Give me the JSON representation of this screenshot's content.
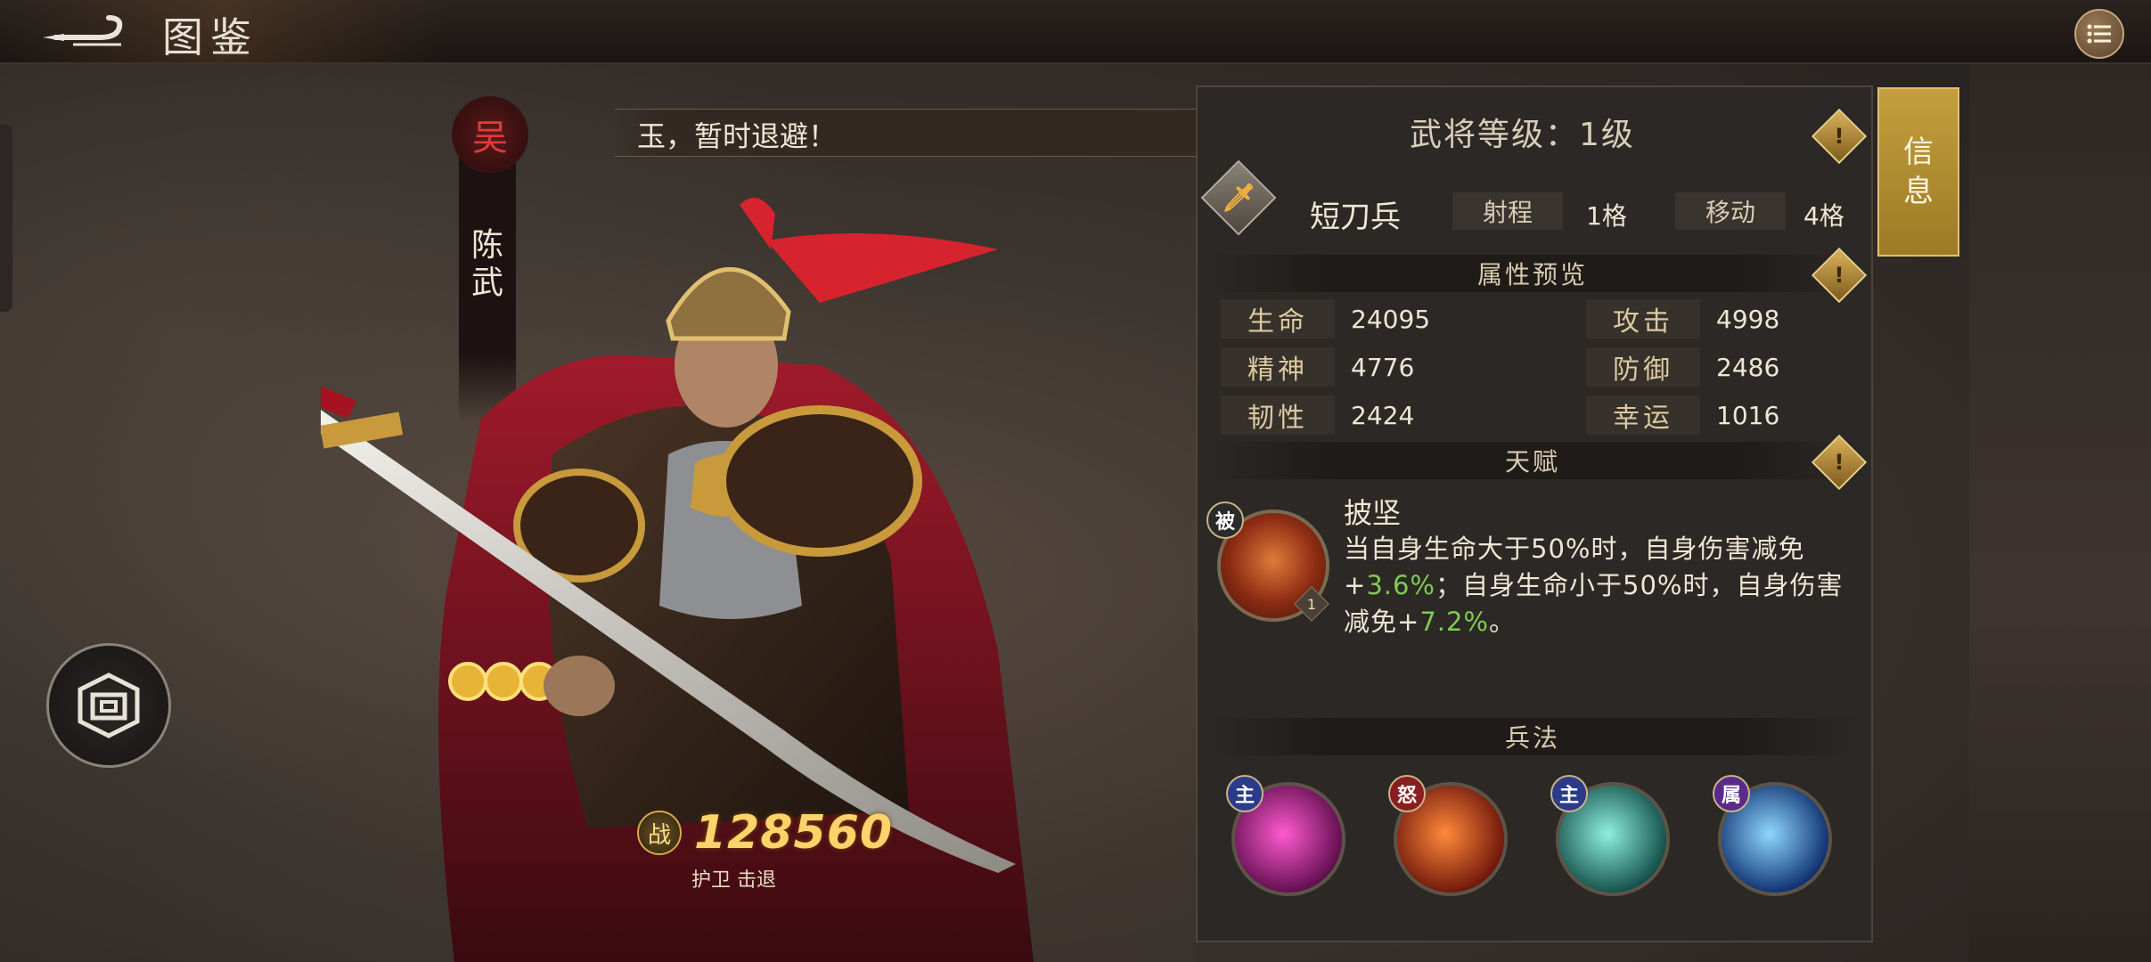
{
  "topbar": {
    "title": "图鉴",
    "back_icon": "back-arrow-icon",
    "menu_icon": "list-menu-icon"
  },
  "hero": {
    "faction": "吴",
    "name": "陈武",
    "quote": "玉，暂时退避！",
    "power_badge": "战",
    "power": "128560",
    "power_tags": "护卫 击退"
  },
  "panel": {
    "level_label": "武将等级：1级",
    "warn_glyph": "!",
    "unit": {
      "icon_glyph": "🗡",
      "name": "短刀兵",
      "range_label": "射程",
      "range_value": "1格",
      "move_label": "移动",
      "move_value": "4格"
    },
    "stats_header": "属性预览",
    "stats": [
      {
        "label": "生命",
        "value": "24095"
      },
      {
        "label": "攻击",
        "value": "4998"
      },
      {
        "label": "精神",
        "value": "4776"
      },
      {
        "label": "防御",
        "value": "2486"
      },
      {
        "label": "韧性",
        "value": "2424"
      },
      {
        "label": "幸运",
        "value": "1016"
      }
    ],
    "talent_header": "天赋",
    "talent": {
      "badge": "被",
      "level": "1",
      "name": "披坚",
      "desc_1": "当自身生命大于50%时，自身伤害减免+",
      "val_1": "3.6%",
      "desc_2": "；自身生命小于50%时，自身伤害减免+",
      "val_2": "7.2%",
      "desc_3": "。"
    },
    "skills_header": "兵法",
    "skills": [
      {
        "badge": "主",
        "badge_color": "#2a3b8a",
        "color_a": "#ff5ad0",
        "color_b": "#5a0b4a"
      },
      {
        "badge": "怒",
        "badge_color": "#8a1e1e",
        "color_a": "#ff8a3a",
        "color_b": "#6a120a"
      },
      {
        "badge": "主",
        "badge_color": "#2a3b8a",
        "color_a": "#8ff0e0",
        "color_b": "#0f4a44"
      },
      {
        "badge": "属",
        "badge_color": "#5a2a8a",
        "color_a": "#8fd8ff",
        "color_b": "#0a2a6a"
      }
    ]
  },
  "side_tab": {
    "label": "信息"
  },
  "colors": {
    "accent_gold": "#c59f3d",
    "talent_green": "#7ecb52",
    "power_gold": "#ffd36a"
  }
}
